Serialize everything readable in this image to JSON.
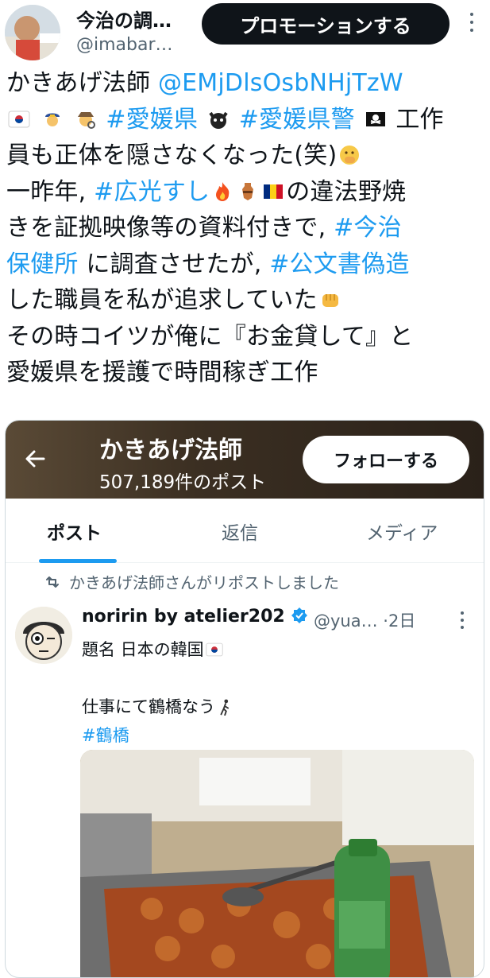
{
  "header": {
    "display_name": "今治の調…",
    "handle": "@imabar…",
    "promote_label": "プロモーションする"
  },
  "tweet": {
    "l1_a": "かきあげ法師 ",
    "l1_mention": "@EMjDlsOsbNHjTzW",
    "l2_tag1": "#愛媛県",
    "l2_tag2": "#愛媛県警",
    "l2_after": "工作",
    "l3": "員も正体を隠さなくなった(笑)",
    "l4_a": "一昨年, ",
    "l4_tag": "#広光すし",
    "l4_after": "の違法野焼",
    "l5_a": "きを証拠映像等の資料付きで, ",
    "l5_tag": "#今治",
    "l6_tag": "保健所",
    "l6_a": " に調査させたが, ",
    "l6_tag2": "#公文書偽造",
    "l7": "した職員を私が追求していた",
    "l8": "その時コイツが俺に『お金貸して』と",
    "l9": "愛媛県を援護で時間稼ぎ工作"
  },
  "card": {
    "title": "かきあげ法師",
    "post_count": "507,189件のポスト",
    "follow_label": "フォローする",
    "tabs": [
      "ポスト",
      "返信",
      "メディア"
    ],
    "repost_text": "かきあげ法師さんがリポストしました",
    "post": {
      "name": "noririn by atelier202",
      "handle": "@yua…",
      "time": "·2日",
      "line1": "題名 日本の韓国",
      "line2": "仕事にて鶴橋なう",
      "hashtag": "#鶴橋"
    }
  },
  "colors": {
    "link": "#1d9bf0",
    "text": "#0f1419",
    "muted": "#536471"
  }
}
